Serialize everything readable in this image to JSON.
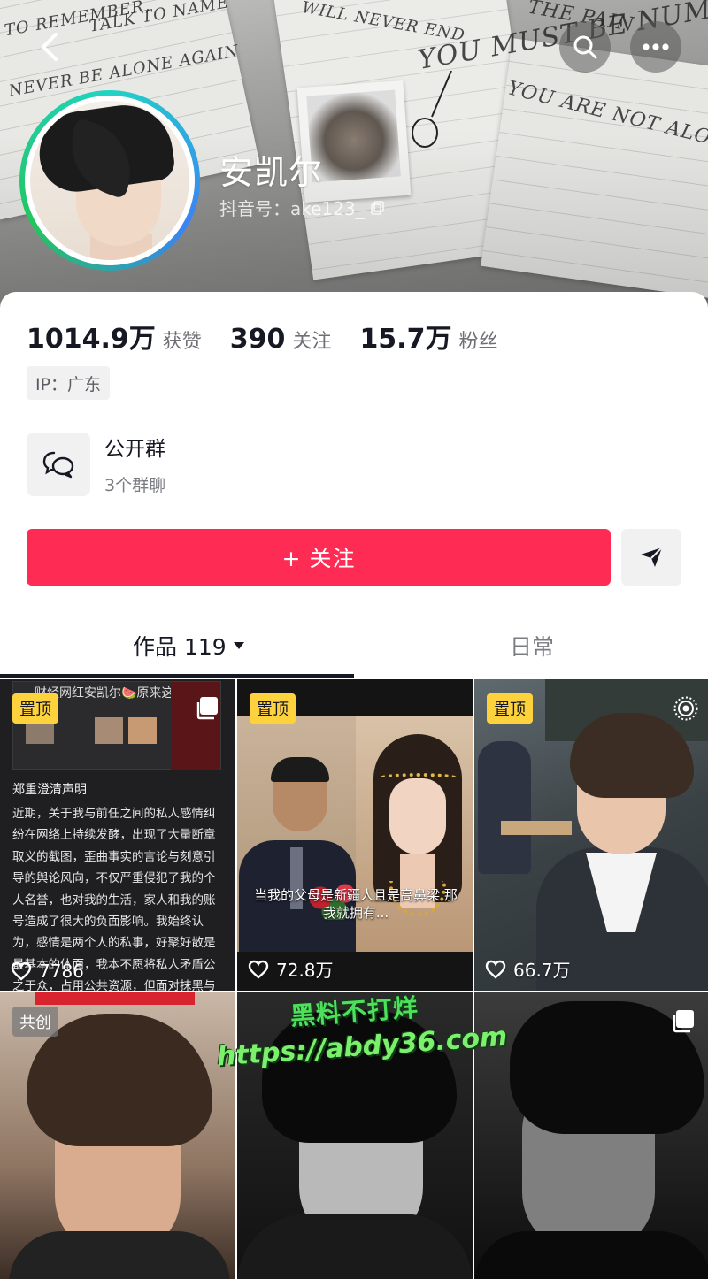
{
  "profile": {
    "name": "安凯尔",
    "douyin_id": "抖音号：ake123_"
  },
  "cover_text": {
    "line1": "TO REMEMBER,",
    "line2": "TALK TO NAME",
    "line3": "NEVER BE ALONE AGAIN",
    "line4": "YOU MUST BE NUMB",
    "line5": "YOU ARE NOT ALONE",
    "line6": "WILL NEVER END",
    "line7": "THE PAIN"
  },
  "stats": {
    "likes": {
      "value": "1014.9万",
      "label": "获赞"
    },
    "following": {
      "value": "390",
      "label": "关注"
    },
    "followers": {
      "value": "15.7万",
      "label": "粉丝"
    }
  },
  "ip_location": "IP：广东",
  "group": {
    "title": "公开群",
    "subtitle": "3个群聊"
  },
  "follow_button": "+ 关注",
  "tabs": {
    "works": "作品 119",
    "daily": "日常"
  },
  "videos": [
    {
      "badge": "置顶",
      "likes": "7786",
      "header_title": "财经网红安凯尔🍉原来这...",
      "statement_title": "郑重澄清声明",
      "statement_body": "近期，关于我与前任之间的私人感情纠纷在网络上持续发酵，出现了大量断章取义的截图，歪曲事实的言论与刻意引导的舆论风向，不仅严重侵犯了我的个人名誉，也对我的生活，家人和我的账号造成了很大的负面影响。我始终认为，感情是两个人的私事，好聚好散是最基本的体面，我本不愿将私人矛盾公之于众，占用公共资源，但面对抹黑与造谣，我必须站出来。"
    },
    {
      "badge": "置顶",
      "likes": "72.8万",
      "caption": "当我的父母是新疆人且是高鼻梁 那我就拥有..."
    },
    {
      "badge": "置顶",
      "likes": "66.7万"
    },
    {
      "badge": "共创",
      "likes": ""
    },
    {
      "badge": "",
      "likes": ""
    },
    {
      "badge": "",
      "likes": ""
    }
  ],
  "watermark": {
    "line1": "黑料不打烊",
    "line2": "https://abdy36.com"
  },
  "colors": {
    "follow_button": "#fe2c55",
    "pin_badge": "#fdd23d",
    "watermark": "#4ee05c"
  }
}
